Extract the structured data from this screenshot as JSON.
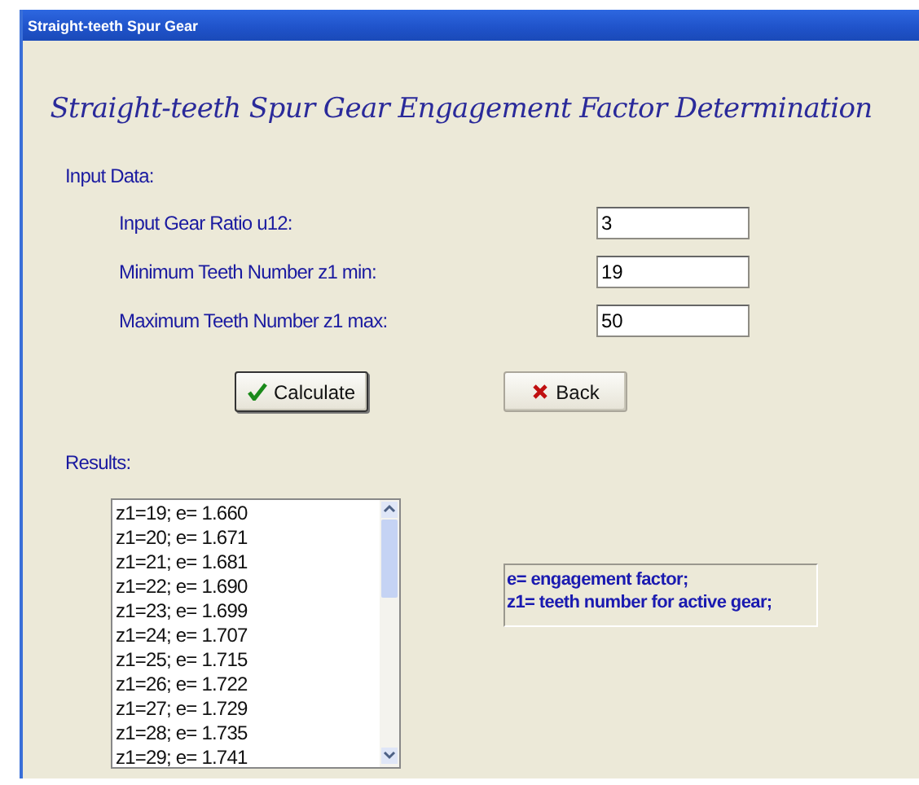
{
  "window": {
    "title": "Straight-teeth Spur Gear"
  },
  "heading": "Straight-teeth Spur Gear Engagement Factor Determination",
  "input_section": {
    "label": "Input Data:",
    "fields": [
      {
        "label": "Input Gear Ratio u12:",
        "value": "3"
      },
      {
        "label": "Minimum Teeth Number z1 min:",
        "value": "19"
      },
      {
        "label": "Maximum Teeth Number z1 max:",
        "value": "50"
      }
    ]
  },
  "buttons": [
    {
      "kind": "calculate",
      "label": "Calculate",
      "focused": true
    },
    {
      "kind": "back",
      "label": "Back",
      "focused": false
    }
  ],
  "results": {
    "label": "Results:",
    "items": [
      "z1=19; e= 1.660",
      "z1=20; e= 1.671",
      "z1=21; e= 1.681",
      "z1=22; e= 1.690",
      "z1=23; e= 1.699",
      "z1=24; e= 1.707",
      "z1=25; e= 1.715",
      "z1=26; e= 1.722",
      "z1=27; e= 1.729",
      "z1=28; e= 1.735",
      "z1=29; e= 1.741"
    ],
    "legend": [
      "e= engagement factor;",
      "z1= teeth number for active gear;"
    ]
  }
}
